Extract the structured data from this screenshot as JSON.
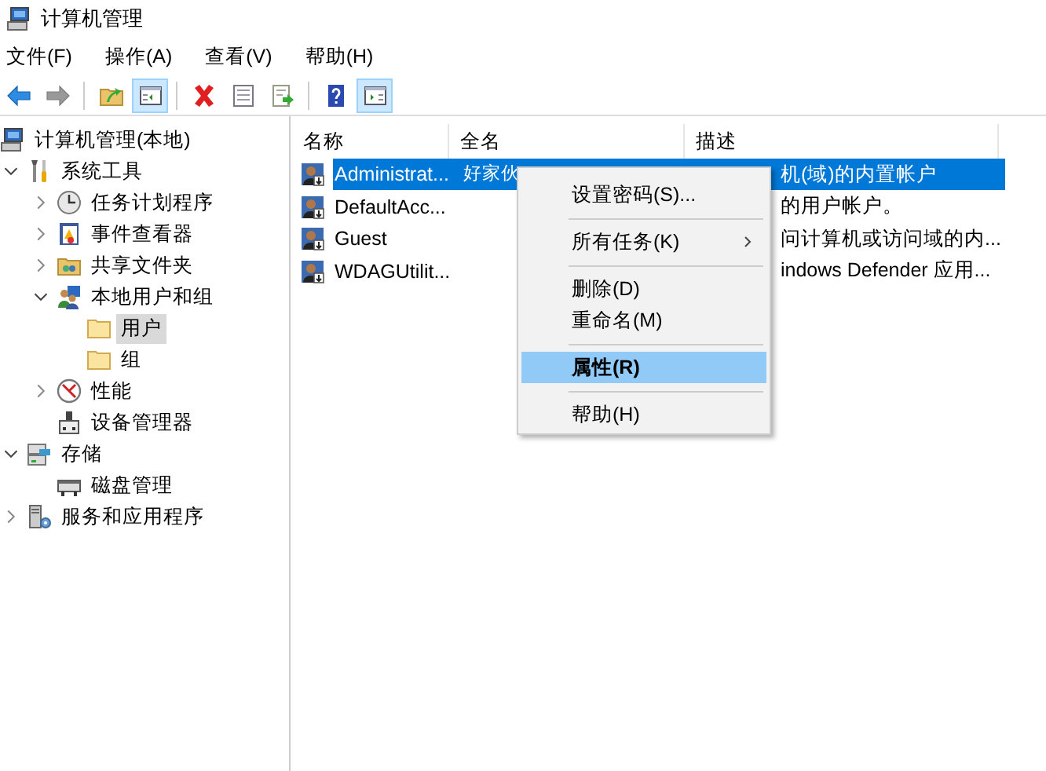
{
  "window": {
    "title": "计算机管理"
  },
  "menu_bar": [
    {
      "label": "文件(F)"
    },
    {
      "label": "操作(A)"
    },
    {
      "label": "查看(V)"
    },
    {
      "label": "帮助(H)"
    }
  ],
  "toolbar": [
    {
      "kind": "button",
      "on": false,
      "disabled": false
    },
    {
      "kind": "button",
      "on": false,
      "disabled": true
    },
    {
      "kind": "separator"
    },
    {
      "kind": "button",
      "on": false,
      "disabled": false
    },
    {
      "kind": "button",
      "on": true,
      "disabled": false
    },
    {
      "kind": "separator"
    },
    {
      "kind": "button",
      "on": false,
      "disabled": false
    },
    {
      "kind": "button",
      "on": false,
      "disabled": false
    },
    {
      "kind": "button",
      "on": false,
      "disabled": false
    },
    {
      "kind": "separator"
    },
    {
      "kind": "button",
      "on": false,
      "disabled": false
    },
    {
      "kind": "button",
      "on": true,
      "disabled": false
    }
  ],
  "tree": {
    "label": "计算机管理(本地)",
    "selected": false,
    "children": [
      {
        "label": "系统工具",
        "expanded": true,
        "selected": false,
        "children": [
          {
            "label": "任务计划程序",
            "expanded": false,
            "selected": false
          },
          {
            "label": "事件查看器",
            "expanded": false,
            "selected": false
          },
          {
            "label": "共享文件夹",
            "expanded": false,
            "selected": false
          },
          {
            "label": "本地用户和组",
            "expanded": true,
            "selected": false,
            "children": [
              {
                "label": "用户",
                "selected": true
              },
              {
                "label": "组",
                "selected": false
              }
            ]
          },
          {
            "label": "性能",
            "expanded": false,
            "selected": false
          },
          {
            "label": "设备管理器",
            "selected": false
          }
        ]
      },
      {
        "label": "存储",
        "expanded": true,
        "selected": false,
        "children": [
          {
            "label": "磁盘管理",
            "selected": false
          }
        ]
      },
      {
        "label": "服务和应用程序",
        "expanded": false,
        "selected": false
      }
    ]
  },
  "table": {
    "columns": [
      "名称",
      "全名",
      "描述"
    ],
    "rows": [
      {
        "name": "Administrat...",
        "full_name": "好家伙",
        "description": "机(域)的内置帐户",
        "selected": true
      },
      {
        "name": "DefaultAcc...",
        "description": "的用户帐户。",
        "selected": false
      },
      {
        "name": "Guest",
        "description": "问计算机或访问域的内...",
        "selected": false
      },
      {
        "name": "WDAGUtilit...",
        "description": "indows Defender 应用...",
        "selected": false
      }
    ]
  },
  "context_menu": [
    {
      "kind": "item",
      "label": "设置密码(S)...",
      "selected": false,
      "default": false,
      "submenu": false
    },
    {
      "kind": "separator"
    },
    {
      "kind": "item",
      "label": "所有任务(K)",
      "selected": false,
      "default": false,
      "submenu": true
    },
    {
      "kind": "separator"
    },
    {
      "kind": "item",
      "label": "删除(D)",
      "selected": false,
      "default": false,
      "submenu": false
    },
    {
      "kind": "item",
      "label": "重命名(M)",
      "selected": false,
      "default": false,
      "submenu": false
    },
    {
      "kind": "separator"
    },
    {
      "kind": "item",
      "label": "属性(R)",
      "selected": true,
      "default": true,
      "submenu": false
    },
    {
      "kind": "separator"
    },
    {
      "kind": "item",
      "label": "帮助(H)",
      "selected": false,
      "default": false,
      "submenu": false
    }
  ]
}
